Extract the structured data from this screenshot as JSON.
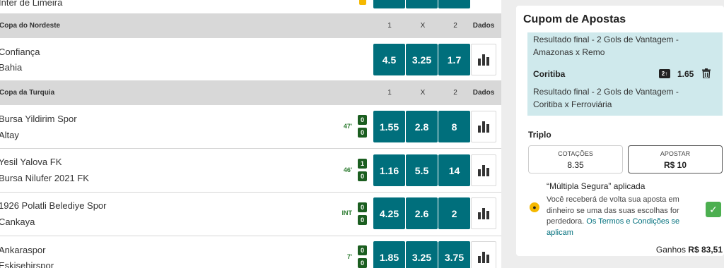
{
  "events": {
    "top_partial": {
      "team": "Inter de Limeira"
    },
    "leagues": [
      {
        "name": "Copa do Nordeste",
        "col1": "1",
        "colx": "X",
        "col2": "2",
        "stats": "Dados"
      },
      {
        "name": "Copa da Turquia",
        "col1": "1",
        "colx": "X",
        "col2": "2",
        "stats": "Dados"
      }
    ],
    "matches": [
      {
        "home": "Confiança",
        "away": "Bahia",
        "time": "",
        "home_score": "",
        "away_score": "",
        "odds": [
          "4.5",
          "3.25",
          "1.7"
        ]
      },
      {
        "home": "Bursa Yildirim Spor",
        "away": "Altay",
        "time": "47'",
        "home_score": "0",
        "away_score": "0",
        "odds": [
          "1.55",
          "2.8",
          "8"
        ]
      },
      {
        "home": "Yesil Yalova FK",
        "away": "Bursa Nilufer 2021 FK",
        "time": "46'",
        "home_score": "1",
        "away_score": "0",
        "odds": [
          "1.16",
          "5.5",
          "14"
        ]
      },
      {
        "home": "1926 Polatli Belediye Spor",
        "away": "Cankaya",
        "time": "INT",
        "home_score": "0",
        "away_score": "0",
        "odds": [
          "4.25",
          "2.6",
          "2"
        ]
      },
      {
        "home": "Ankaraspor",
        "away": "Eskisehirspor",
        "time": "7'",
        "home_score": "0",
        "away_score": "0",
        "odds": [
          "1.85",
          "3.25",
          "3.75"
        ]
      }
    ]
  },
  "betslip": {
    "title": "Cupom de Apostas",
    "bets": [
      {
        "market": "Resultado final - 2 Gols de Vantagem -",
        "event": "Amazonas x Remo"
      },
      {
        "selection": "Coritiba",
        "boost": "2↑",
        "odd": "1.65",
        "market": "Resultado final - 2 Gols de Vantagem -",
        "event": "Coritiba x Ferroviária"
      }
    ],
    "type": "Triplo",
    "cotacoes_label": "COTAÇÕES",
    "cotacoes_value": "8.35",
    "apostar_label": "APOSTAR",
    "apostar_value": "R$ 10",
    "multipla_title": "“Múltipla Segura” aplicada",
    "multipla_text": "Você receberá de volta sua aposta em dinheiro se uma das suas escolhas for perdedora.",
    "terms_link": "Os Termos e Condições se aplicam",
    "ganhos_label": "Ganhos",
    "ganhos_value": "R$ 83,51"
  },
  "colors": {
    "odds_bg": "#006f7c",
    "live_score": "#1b5e20",
    "betslip_bg": "#cfe9ec",
    "accent_check": "#4caf50"
  },
  "icons": {
    "stats": "bar-chart-icon",
    "trash": "trash-icon",
    "boost": "odds-boost-icon",
    "coin": "coin-icon",
    "check": "checkbox-checked-icon"
  }
}
